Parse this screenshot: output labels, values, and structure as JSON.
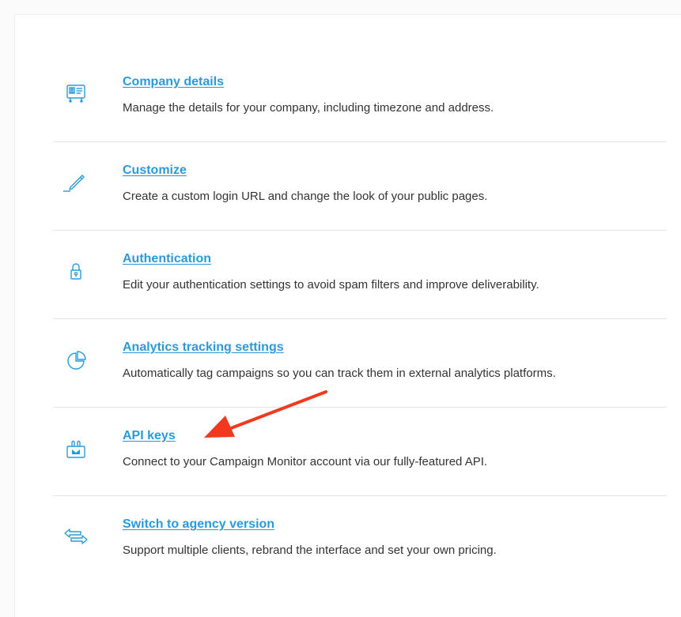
{
  "colors": {
    "link": "#2a9bd8",
    "icon": "#2a9bd8",
    "text": "#333333",
    "divider": "#e4e4e4",
    "annotation_arrow": "#f0391e"
  },
  "settings": {
    "items": [
      {
        "title": "Company details",
        "description": "Manage the details for your company, including timezone and address.",
        "icon": "id-card-icon"
      },
      {
        "title": "Customize",
        "description": "Create a custom login URL and change the look of your public pages.",
        "icon": "pencil-icon"
      },
      {
        "title": "Authentication",
        "description": "Edit your authentication settings to avoid spam filters and improve deliverability.",
        "icon": "lock-icon"
      },
      {
        "title": "Analytics tracking settings",
        "description": "Automatically tag campaigns so you can track them in external analytics platforms.",
        "icon": "pie-chart-icon"
      },
      {
        "title": "API keys",
        "description": "Connect to your Campaign Monitor account via our fully-featured API.",
        "icon": "plug-icon"
      },
      {
        "title": "Switch to agency version",
        "description": "Support multiple clients, rebrand the interface and set your own pricing.",
        "icon": "swap-arrows-icon"
      }
    ]
  },
  "annotation": {
    "icon": "red-arrow-icon",
    "points_to": "API keys"
  }
}
